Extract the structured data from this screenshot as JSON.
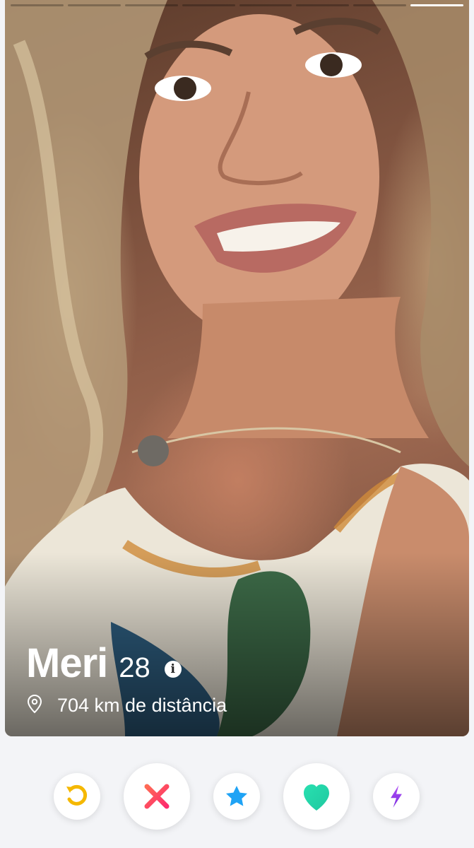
{
  "profile": {
    "name": "Meri",
    "age": "28",
    "distance": "704 km de distância",
    "photo_count": 8,
    "active_photo_index": 7
  },
  "actions": [
    {
      "name": "rewind",
      "icon": "rewind-icon",
      "color": "#f5b800"
    },
    {
      "name": "nope",
      "icon": "x-icon",
      "color": "#fd2b6e"
    },
    {
      "name": "super-like",
      "icon": "star-icon",
      "color": "#1fa3f5"
    },
    {
      "name": "like",
      "icon": "heart-icon",
      "color": "#22d3a4"
    },
    {
      "name": "boost",
      "icon": "lightning-icon",
      "color": "#9b3bf0"
    }
  ]
}
